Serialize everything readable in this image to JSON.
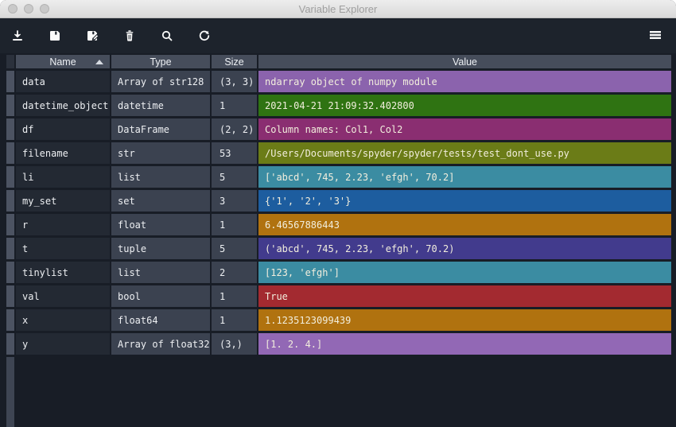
{
  "window": {
    "title": "Variable Explorer"
  },
  "toolbar": {
    "buttons": [
      {
        "name": "import-data",
        "icon": "import-icon"
      },
      {
        "name": "save-data",
        "icon": "save-icon"
      },
      {
        "name": "save-data-as",
        "icon": "save-as-icon"
      },
      {
        "name": "remove-variable",
        "icon": "trash-icon"
      },
      {
        "name": "search",
        "icon": "search-icon"
      },
      {
        "name": "refresh",
        "icon": "refresh-icon"
      }
    ],
    "menu_icon": "hamburger-icon"
  },
  "table": {
    "columns": [
      "Name",
      "Type",
      "Size",
      "Value"
    ],
    "sort": {
      "column": "Name",
      "direction": "ascending"
    },
    "rows": [
      {
        "name": "data",
        "type": "Array of str128",
        "size": "(3, 3)",
        "value": "ndarray object of numpy module",
        "color": "#8b63ad"
      },
      {
        "name": "datetime_object",
        "type": "datetime",
        "size": "1",
        "value": "2021-04-21 21:09:32.402800",
        "color": "#2f7312"
      },
      {
        "name": "df",
        "type": "DataFrame",
        "size": "(2, 2)",
        "value": "Column names: Col1, Col2",
        "color": "#8a2e71"
      },
      {
        "name": "filename",
        "type": "str",
        "size": "53",
        "value": "/Users/Documents/spyder/spyder/tests/test_dont_use.py",
        "color": "#6b7c17"
      },
      {
        "name": "li",
        "type": "list",
        "size": "5",
        "value": "['abcd', 745, 2.23, 'efgh', 70.2]",
        "color": "#3b8ca2"
      },
      {
        "name": "my_set",
        "type": "set",
        "size": "3",
        "value": "{'1', '2', '3'}",
        "color": "#1d5d9f"
      },
      {
        "name": "r",
        "type": "float",
        "size": "1",
        "value": "6.46567886443",
        "color": "#b0720f"
      },
      {
        "name": "t",
        "type": "tuple",
        "size": "5",
        "value": "('abcd', 745, 2.23, 'efgh', 70.2)",
        "color": "#423b8d"
      },
      {
        "name": "tinylist",
        "type": "list",
        "size": "2",
        "value": "[123, 'efgh']",
        "color": "#3b8ca2"
      },
      {
        "name": "val",
        "type": "bool",
        "size": "1",
        "value": "True",
        "color": "#a32a30"
      },
      {
        "name": "x",
        "type": "float64",
        "size": "1",
        "value": "1.1235123099439",
        "color": "#b0720f"
      },
      {
        "name": "y",
        "type": "Array of float32",
        "size": "(3,)",
        "value": "[1. 2. 4.]",
        "color": "#9268b5"
      }
    ]
  }
}
